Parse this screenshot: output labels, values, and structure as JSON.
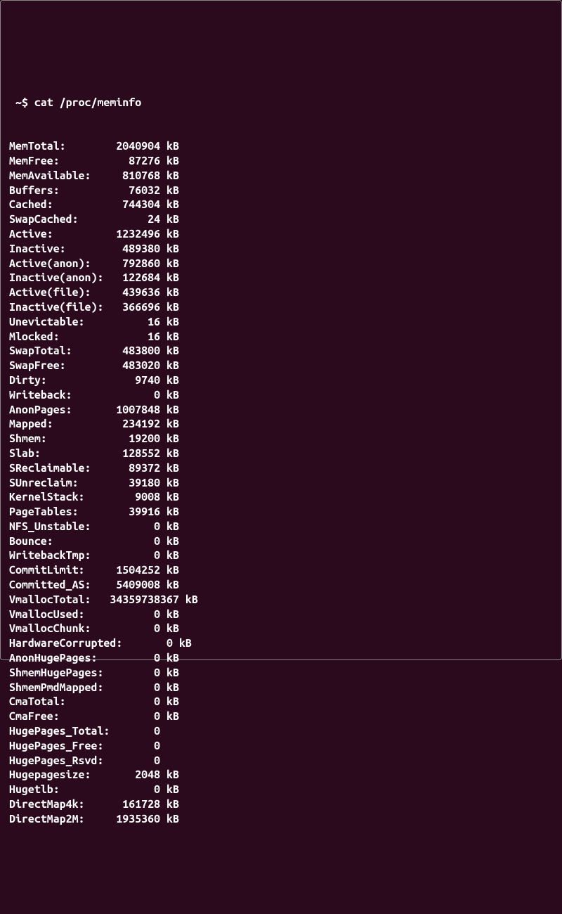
{
  "prompt": " ~$ ",
  "command": "cat /proc/meminfo",
  "entries": [
    {
      "label": "MemTotal:",
      "value": "2040904",
      "unit": "kB"
    },
    {
      "label": "MemFree:",
      "value": "87276",
      "unit": "kB"
    },
    {
      "label": "MemAvailable:",
      "value": "810768",
      "unit": "kB"
    },
    {
      "label": "Buffers:",
      "value": "76032",
      "unit": "kB"
    },
    {
      "label": "Cached:",
      "value": "744304",
      "unit": "kB"
    },
    {
      "label": "SwapCached:",
      "value": "24",
      "unit": "kB"
    },
    {
      "label": "Active:",
      "value": "1232496",
      "unit": "kB"
    },
    {
      "label": "Inactive:",
      "value": "489380",
      "unit": "kB"
    },
    {
      "label": "Active(anon):",
      "value": "792860",
      "unit": "kB"
    },
    {
      "label": "Inactive(anon):",
      "value": "122684",
      "unit": "kB"
    },
    {
      "label": "Active(file):",
      "value": "439636",
      "unit": "kB"
    },
    {
      "label": "Inactive(file):",
      "value": "366696",
      "unit": "kB"
    },
    {
      "label": "Unevictable:",
      "value": "16",
      "unit": "kB"
    },
    {
      "label": "Mlocked:",
      "value": "16",
      "unit": "kB"
    },
    {
      "label": "SwapTotal:",
      "value": "483800",
      "unit": "kB"
    },
    {
      "label": "SwapFree:",
      "value": "483020",
      "unit": "kB"
    },
    {
      "label": "Dirty:",
      "value": "9740",
      "unit": "kB"
    },
    {
      "label": "Writeback:",
      "value": "0",
      "unit": "kB"
    },
    {
      "label": "AnonPages:",
      "value": "1007848",
      "unit": "kB"
    },
    {
      "label": "Mapped:",
      "value": "234192",
      "unit": "kB"
    },
    {
      "label": "Shmem:",
      "value": "19200",
      "unit": "kB"
    },
    {
      "label": "Slab:",
      "value": "128552",
      "unit": "kB"
    },
    {
      "label": "SReclaimable:",
      "value": "89372",
      "unit": "kB"
    },
    {
      "label": "SUnreclaim:",
      "value": "39180",
      "unit": "kB"
    },
    {
      "label": "KernelStack:",
      "value": "9008",
      "unit": "kB"
    },
    {
      "label": "PageTables:",
      "value": "39916",
      "unit": "kB"
    },
    {
      "label": "NFS_Unstable:",
      "value": "0",
      "unit": "kB"
    },
    {
      "label": "Bounce:",
      "value": "0",
      "unit": "kB"
    },
    {
      "label": "WritebackTmp:",
      "value": "0",
      "unit": "kB"
    },
    {
      "label": "CommitLimit:",
      "value": "1504252",
      "unit": "kB"
    },
    {
      "label": "Committed_AS:",
      "value": "5409008",
      "unit": "kB"
    },
    {
      "label": "VmallocTotal:",
      "value": "34359738367",
      "unit": "kB"
    },
    {
      "label": "VmallocUsed:",
      "value": "0",
      "unit": "kB"
    },
    {
      "label": "VmallocChunk:",
      "value": "0",
      "unit": "kB"
    },
    {
      "label": "HardwareCorrupted:",
      "value": "0",
      "unit": "kB"
    },
    {
      "label": "AnonHugePages:",
      "value": "0",
      "unit": "kB"
    },
    {
      "label": "ShmemHugePages:",
      "value": "0",
      "unit": "kB"
    },
    {
      "label": "ShmemPmdMapped:",
      "value": "0",
      "unit": "kB"
    },
    {
      "label": "CmaTotal:",
      "value": "0",
      "unit": "kB"
    },
    {
      "label": "CmaFree:",
      "value": "0",
      "unit": "kB"
    },
    {
      "label": "HugePages_Total:",
      "value": "0",
      "unit": ""
    },
    {
      "label": "HugePages_Free:",
      "value": "0",
      "unit": ""
    },
    {
      "label": "HugePages_Rsvd:",
      "value": "0",
      "unit": ""
    },
    {
      "label": "Hugepagesize:",
      "value": "2048",
      "unit": "kB"
    },
    {
      "label": "Hugetlb:",
      "value": "0",
      "unit": "kB"
    },
    {
      "label": "DirectMap4k:",
      "value": "161728",
      "unit": "kB"
    },
    {
      "label": "DirectMap2M:",
      "value": "1935360",
      "unit": "kB"
    }
  ]
}
